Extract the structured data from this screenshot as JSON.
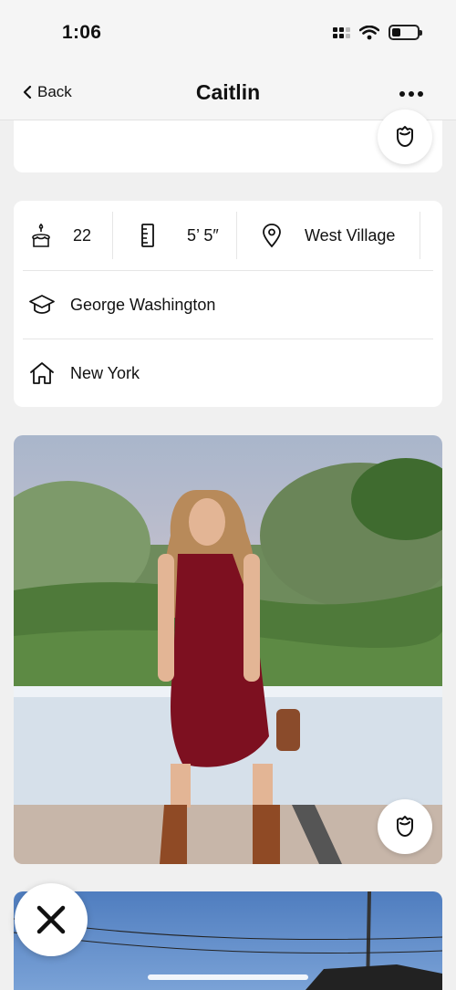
{
  "status_bar": {
    "time": "1:06",
    "battery_level": 0.35
  },
  "nav": {
    "back_label": "Back",
    "title": "Caitlin"
  },
  "profile": {
    "age": "22",
    "height": "5’ 5″",
    "neighborhood": "West Village",
    "school": "George Washington",
    "hometown": "New York"
  },
  "icons": {
    "age": "birthday-cake-icon",
    "height": "ruler-icon",
    "location": "location-pin-icon",
    "school": "graduation-cap-icon",
    "hometown": "house-icon",
    "like": "rose-icon",
    "skip": "x-icon"
  },
  "colors": {
    "background": "#f0f0f0",
    "card": "#ffffff",
    "text": "#111111"
  }
}
